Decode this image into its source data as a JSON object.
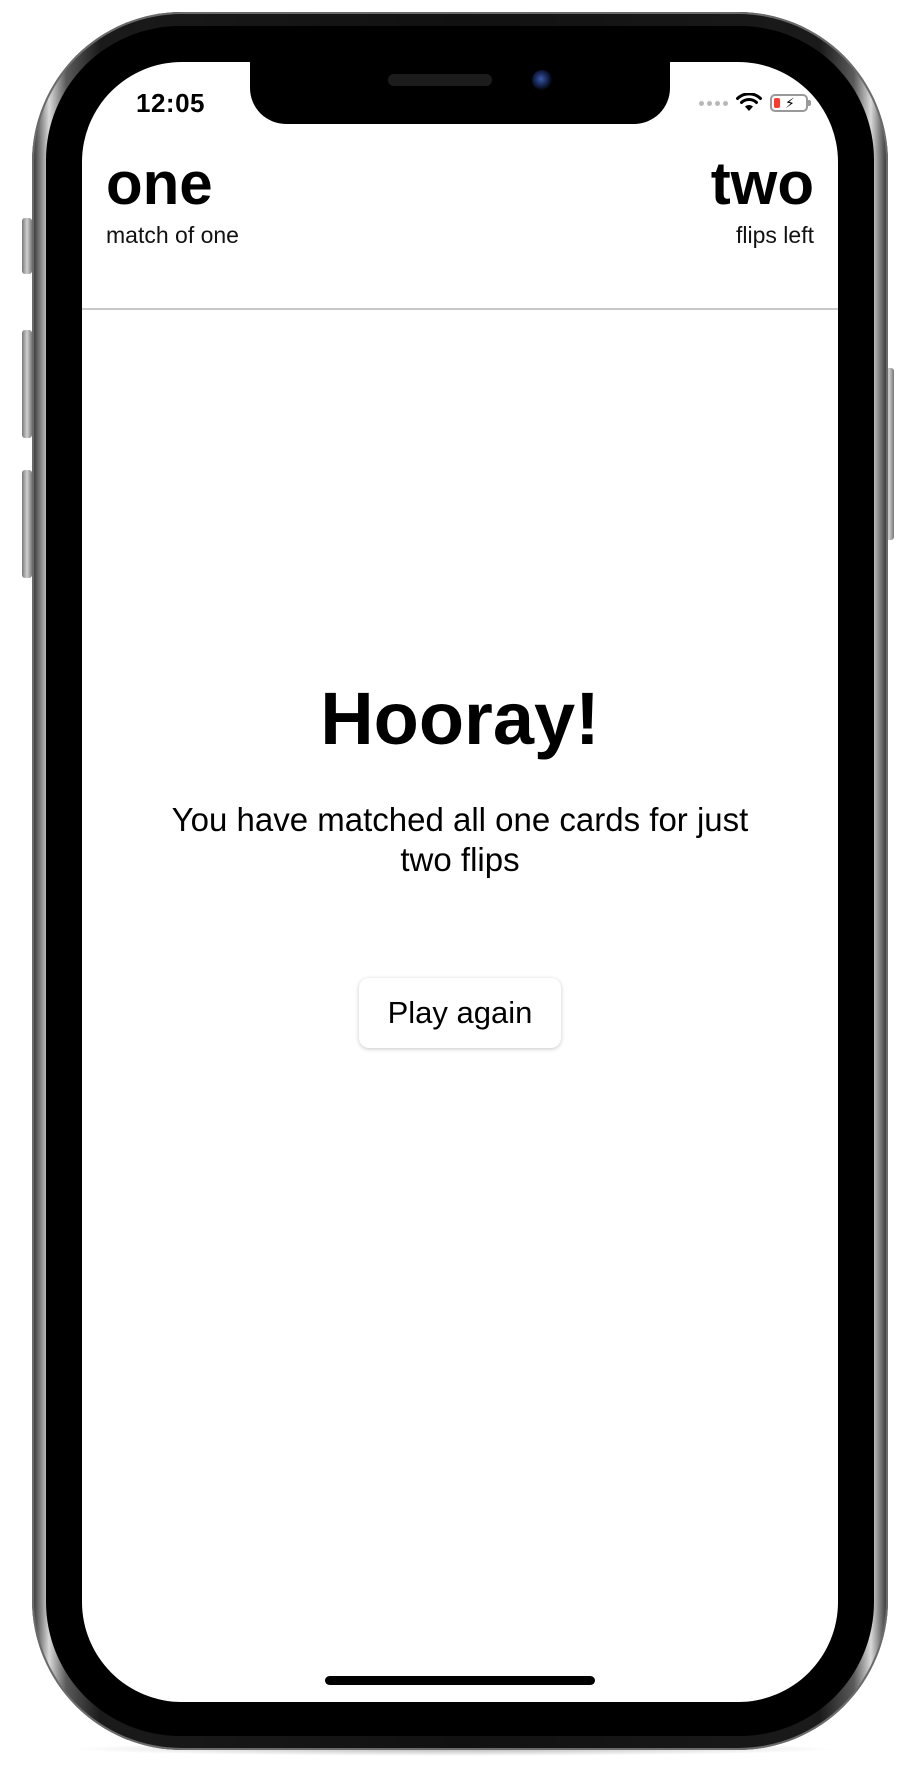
{
  "status_bar": {
    "time": "12:05",
    "icons": [
      "signal-dots-icon",
      "wifi-icon",
      "battery-charging-icon"
    ],
    "battery_color": "#ff3b30"
  },
  "header": {
    "left": {
      "value": "one",
      "caption": "match of one"
    },
    "right": {
      "value": "two",
      "caption": "flips left"
    }
  },
  "result": {
    "title": "Hooray!",
    "message": "You have matched all one cards for just two flips",
    "play_again_label": "Play again"
  }
}
